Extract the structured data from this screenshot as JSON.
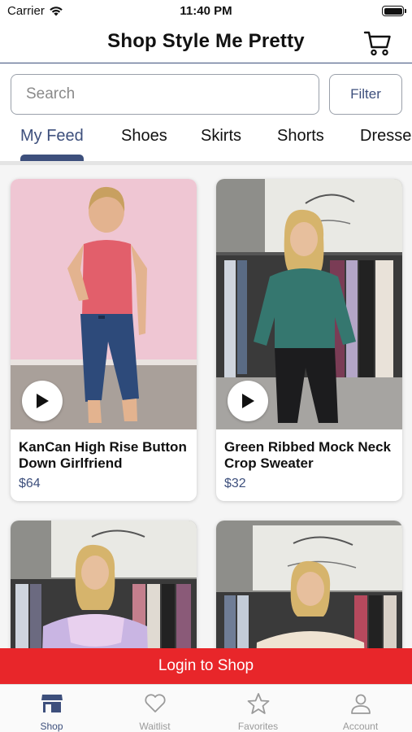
{
  "status": {
    "carrier": "Carrier",
    "time": "11:40 PM"
  },
  "nav": {
    "title": "Shop Style Me Pretty",
    "cart_icon": "cart-icon"
  },
  "search": {
    "placeholder": "Search",
    "filter_label": "Filter"
  },
  "tabs": [
    {
      "label": "My Feed",
      "active": true
    },
    {
      "label": "Shoes"
    },
    {
      "label": "Skirts"
    },
    {
      "label": "Shorts"
    },
    {
      "label": "Dresses"
    }
  ],
  "products": [
    {
      "title": "KanCan High Rise Button Down Girlfriend",
      "price": "$64",
      "has_video": true
    },
    {
      "title": "Green Ribbed Mock Neck Crop Sweater",
      "price": "$32",
      "has_video": true
    },
    {
      "title": "",
      "price": ""
    },
    {
      "title": "",
      "price": ""
    }
  ],
  "banner": {
    "label": "Login to Shop"
  },
  "tab_bar": [
    {
      "label": "Shop",
      "icon": "storefront-icon",
      "active": true
    },
    {
      "label": "Waitlist",
      "icon": "heart-icon"
    },
    {
      "label": "Favorites",
      "icon": "star-icon"
    },
    {
      "label": "Account",
      "icon": "person-icon"
    }
  ],
  "colors": {
    "accent": "#3d4f7c",
    "banner": "#e8262a",
    "inactive": "#9a9a9a"
  }
}
